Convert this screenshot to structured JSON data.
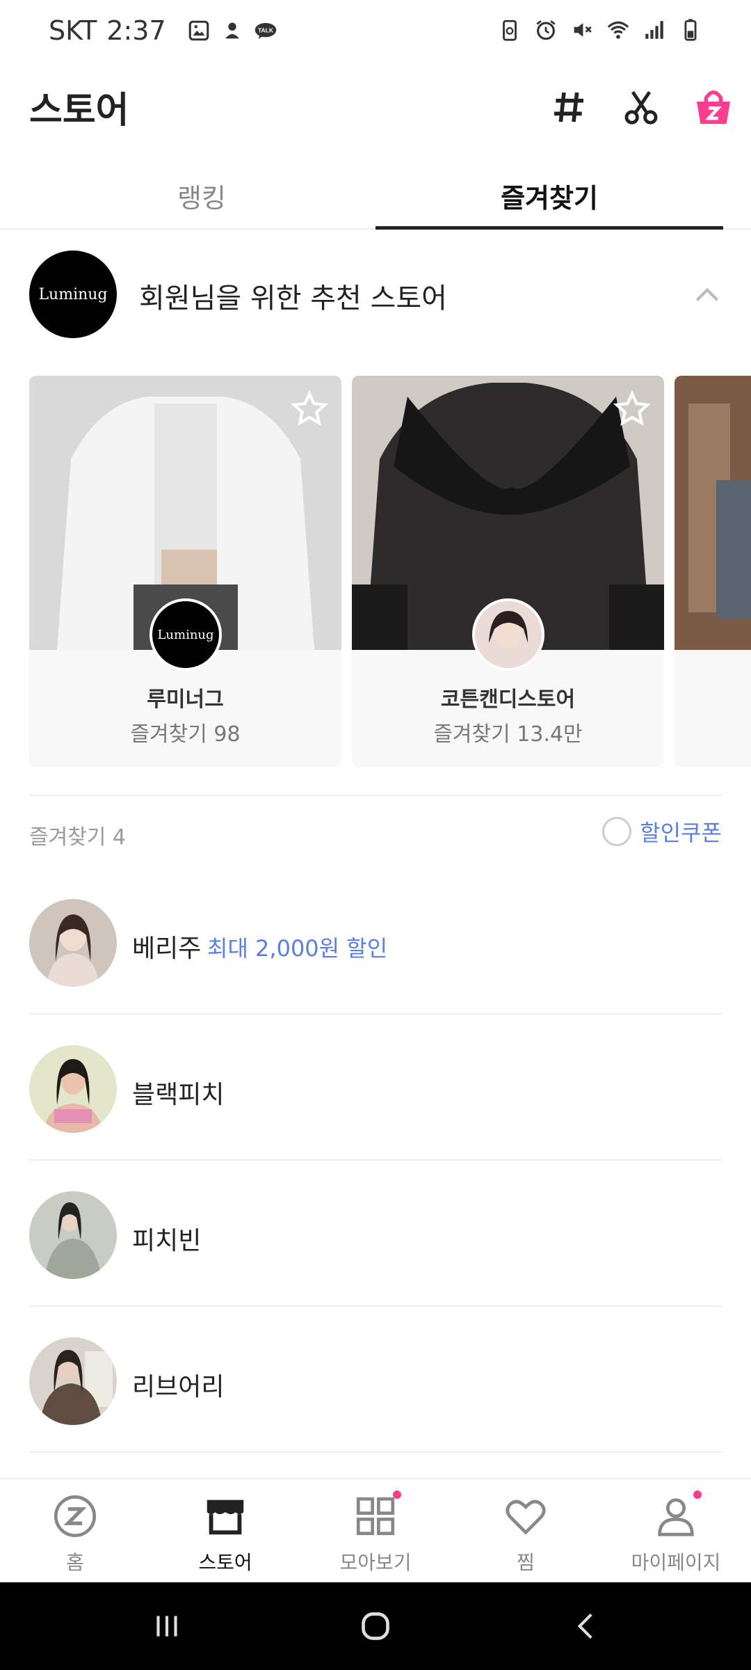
{
  "status_bar": {
    "carrier": "SKT",
    "time": "2:37",
    "talk_badge": "TALK"
  },
  "header": {
    "title": "스토어"
  },
  "tabs": [
    {
      "label": "랭킹",
      "active": false
    },
    {
      "label": "즐겨찾기",
      "active": true
    }
  ],
  "recommend": {
    "logo_text": "Luminug",
    "title": "회원님을 위한 추천 스토어",
    "cards": [
      {
        "name": "루미너그",
        "favorites": "즐겨찾기 98",
        "avatar_text": "Luminug"
      },
      {
        "name": "코튼캔디스토어",
        "favorites": "즐겨찾기 13.4만"
      }
    ]
  },
  "favorites": {
    "count_label": "즐겨찾기 4",
    "coupon_label": "할인쿠폰",
    "stores": [
      {
        "name": "베리주",
        "discount": "최대 2,000원 할인"
      },
      {
        "name": "블랙피치",
        "discount": ""
      },
      {
        "name": "피치빈",
        "discount": ""
      },
      {
        "name": "리브어리",
        "discount": ""
      }
    ]
  },
  "bottom_nav": [
    {
      "label": "홈",
      "icon": "zigzag-home-icon",
      "active": false
    },
    {
      "label": "스토어",
      "icon": "store-icon",
      "active": true
    },
    {
      "label": "모아보기",
      "icon": "grid-icon",
      "active": false,
      "dot": true
    },
    {
      "label": "찜",
      "icon": "heart-icon",
      "active": false
    },
    {
      "label": "마이페이지",
      "icon": "person-icon",
      "active": false,
      "dot": true
    }
  ],
  "colors": {
    "accent": "#ff3c8e",
    "link_blue": "#5b7ee5",
    "text": "#222222"
  }
}
